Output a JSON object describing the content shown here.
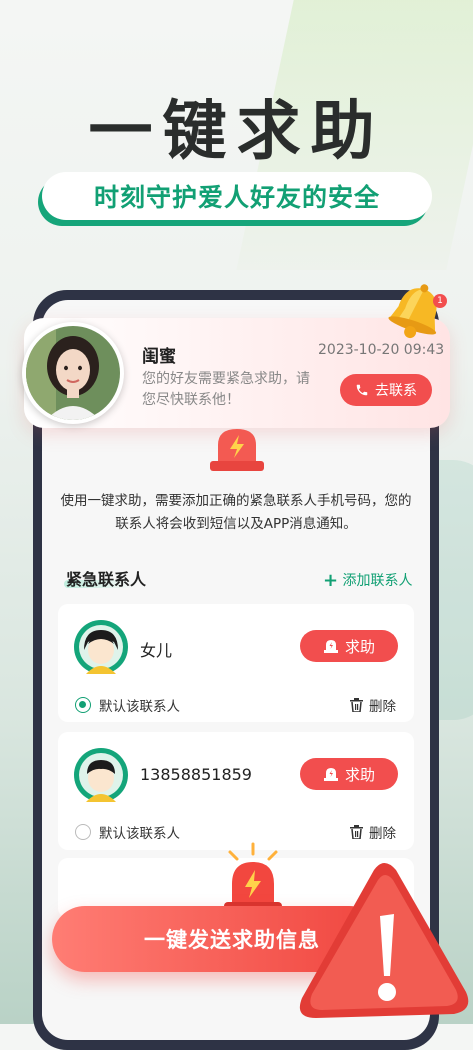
{
  "hero": {
    "title": "一键求助",
    "subtitle": "时刻守护爱人好友的安全"
  },
  "notification": {
    "name": "闺蜜",
    "time": "2023-10-20  09:43",
    "message": "您的好友需要紧急求助，请您尽快联系他！",
    "action_label": "去联系",
    "bell_badge": "1"
  },
  "info_text": "使用一键求助，需要添加正确的紧急联系人手机号码，您的联系人将会收到短信以及APP消息通知。",
  "contacts_section": {
    "title": "紧急联系人",
    "add_label": "添加联系人",
    "help_label": "求助",
    "default_label": "默认该联系人",
    "delete_label": "删除",
    "items": [
      {
        "name": "女儿",
        "is_default": true,
        "avatar": "girl-avatar"
      },
      {
        "name": "13858851859",
        "is_default": false,
        "avatar": "boy-avatar"
      }
    ]
  },
  "send_button": {
    "label": "一键发送求助信息"
  },
  "colors": {
    "accent_green": "#12a074",
    "alert_red": "#f24e4e",
    "hero_text": "#2a2d2c"
  }
}
